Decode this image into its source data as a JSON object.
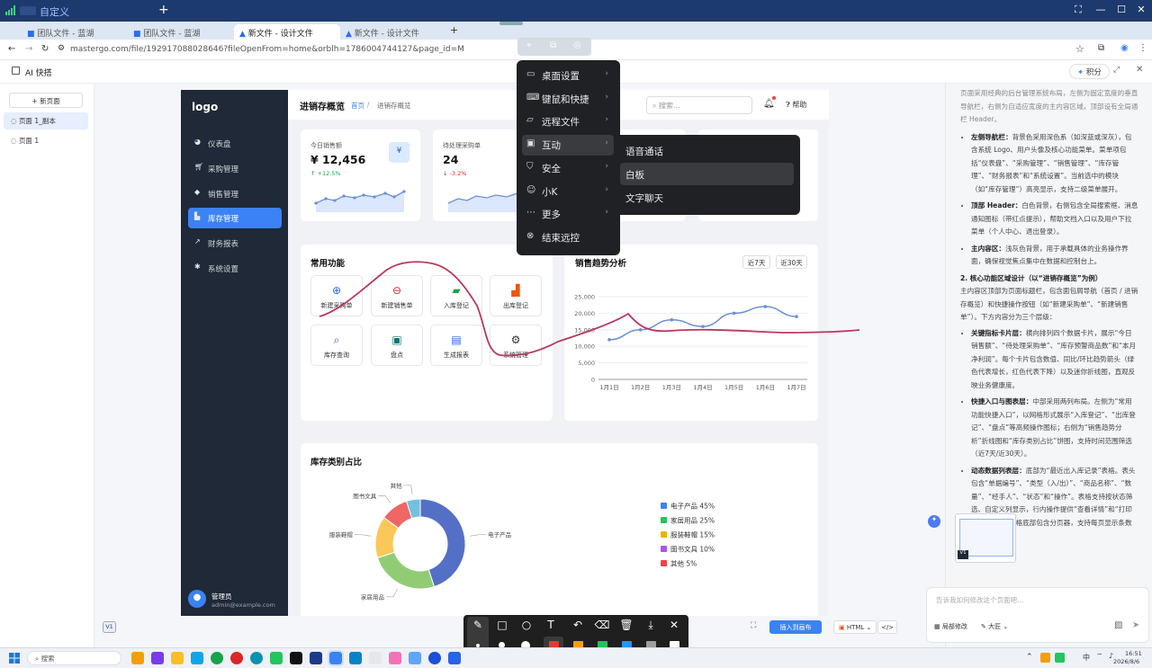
{
  "session": {
    "title": "自定义"
  },
  "browser": {
    "tabs": [
      {
        "label": "团队文件 - 蓝湖"
      },
      {
        "label": "团队文件 - 蓝湖"
      },
      {
        "label": "新文件 - 设计文件"
      },
      {
        "label": "新文件 - 设计文件"
      }
    ],
    "url": "mastergo.com/file/192917088028646?fileOpenFrom=home&orblh=1786004744127&page_id=M"
  },
  "app": {
    "title": "AI 快搭",
    "points_label": "积分"
  },
  "pages_panel": {
    "new_page": "+ 新页面",
    "pages": [
      {
        "label": "页面 1_副本"
      },
      {
        "label": "页面 1"
      }
    ]
  },
  "design": {
    "logo": "logo",
    "nav": [
      {
        "label": "仪表盘",
        "icon": "dashboard-icon"
      },
      {
        "label": "采购管理",
        "icon": "cart-icon"
      },
      {
        "label": "销售管理",
        "icon": "tag-icon"
      },
      {
        "label": "库存管理",
        "icon": "warehouse-icon"
      },
      {
        "label": "财务报表",
        "icon": "chart-icon"
      },
      {
        "label": "系统设置",
        "icon": "gear-icon"
      }
    ],
    "header": {
      "title": "进销存概览",
      "crumb1": "首页",
      "crumb_sep": "/",
      "crumb2": "进销存概览",
      "search_placeholder": "搜索...",
      "help": "帮助"
    },
    "user": {
      "name": "管理员",
      "email": "admin@example.com"
    },
    "stats": [
      {
        "label": "今日销售额",
        "value": "¥ 12,456",
        "change": "+12.5%",
        "badge": "¥"
      },
      {
        "label": "待处理采购单",
        "value": "24",
        "change": "-3.2%"
      }
    ],
    "quick": {
      "title": "常用功能",
      "items": [
        {
          "label": "新建采购单",
          "icon": "plus-circle-icon"
        },
        {
          "label": "新建销售单",
          "icon": "minus-circle-icon"
        },
        {
          "label": "入库登记",
          "icon": "truck-icon"
        },
        {
          "label": "出库登记",
          "icon": "boxes-icon"
        },
        {
          "label": "库存查询",
          "icon": "search-icon"
        },
        {
          "label": "盘点",
          "icon": "clipboard-icon"
        },
        {
          "label": "生成报表",
          "icon": "report-icon"
        },
        {
          "label": "系统管理",
          "icon": "cogs-icon"
        }
      ]
    },
    "trend": {
      "title": "销售趋势分析",
      "btn7": "近7天",
      "btn30": "近30天"
    },
    "pie_title": "库存类别占比",
    "version": "V1"
  },
  "chart_data": [
    {
      "type": "line",
      "x": [
        "1月1日",
        "1月2日",
        "1月3日",
        "1月4日",
        "1月5日",
        "1月6日",
        "1月7日"
      ],
      "series": [
        {
          "values": [
            12000,
            15000,
            18000,
            16000,
            20000,
            22000,
            19000
          ]
        }
      ],
      "ylim": [
        0,
        25000
      ],
      "yticks": [
        "0",
        "5,000",
        "10,000",
        "15,000",
        "20,000",
        "25,000"
      ],
      "color": "#6b8fd8"
    },
    {
      "type": "pie",
      "donut": true,
      "slices": [
        {
          "name": "电子产品",
          "value": 45,
          "color": "#5470c6"
        },
        {
          "name": "家居用品",
          "value": 25,
          "color": "#91cc75"
        },
        {
          "name": "服装鞋帽",
          "value": 15,
          "color": "#fac858"
        },
        {
          "name": "图书文具",
          "value": 10,
          "color": "#ee6666"
        },
        {
          "name": "其他",
          "value": 5,
          "color": "#73c0de"
        }
      ],
      "legend": [
        {
          "text": "电子产品 45%",
          "color": "#3b82f6"
        },
        {
          "text": "家居用品 25%",
          "color": "#22c55e"
        },
        {
          "text": "服装鞋帽 15%",
          "color": "#eab308"
        },
        {
          "text": "图书文具 10%",
          "color": "#a855f7"
        },
        {
          "text": "其他 5%",
          "color": "#ef4444"
        }
      ],
      "legend_position": "right"
    }
  ],
  "context_menu": {
    "items": [
      {
        "label": "桌面设置",
        "icon": "monitor-icon"
      },
      {
        "label": "键鼠和快捷",
        "icon": "keyboard-icon"
      },
      {
        "label": "远程文件",
        "icon": "folder-icon"
      },
      {
        "label": "互动",
        "icon": "interact-icon"
      },
      {
        "label": "安全",
        "icon": "shield-icon"
      },
      {
        "label": "小K",
        "icon": "bot-icon"
      },
      {
        "label": "更多",
        "icon": "more-icon"
      },
      {
        "label": "结束远控",
        "icon": "stop-icon"
      }
    ],
    "submenu": [
      {
        "label": "语音通话"
      },
      {
        "label": "白板"
      },
      {
        "label": "文字聊天"
      }
    ]
  },
  "ai_panel": {
    "intro": "页面采用经典的后台管理系统布局，左侧为固定宽度的垂直导航栏，右侧为自适应宽度的主内容区域，顶部设有全局通栏 Header。",
    "items1": [
      {
        "title": "左侧导航栏：",
        "text": "背景色采用深色系（如深蓝或深灰），包含系统 Logo、用户头像及核心功能菜单。菜单项包括“仪表盘”、“采购管理”、“销售管理”、“库存管理”、“财务报表”和“系统设置”。当前选中的模块（如“库存管理”）高亮显示，支持二级菜单展开。"
      },
      {
        "title": "顶部 Header：",
        "text": "白色背景，右侧包含全局搜索框、消息通知图标（带红点提示），帮助文档入口以及用户下拉菜单（个人中心、退出登录）。"
      },
      {
        "title": "主内容区：",
        "text": "浅灰色背景，用于承载具体的业务操作界面，确保视觉焦点集中在数据和控制台上。"
      }
    ],
    "section2": "2. 核心功能区域设计（以“进销存概览”为例）",
    "section2_text": "主内容区顶部为页面标题栏，包含面包屑导航（首页 / 进销存概览）和快捷操作按钮（如“新建采购单”、“新建销售单”）。下方内容分为三个层级：",
    "items2": [
      {
        "title": "关键指标卡片层：",
        "text": "横向排列四个数据卡片，展示“今日销售额”、“待处理采购单”、“库存预警商品数”和“本月净利润”。每个卡片包含数值、同比/环比趋势箭头（绿色代表增长，红色代表下降）以及迷你折线图，直观反映业务健康度。"
      },
      {
        "title": "快捷入口与图表层：",
        "text": "中部采用两列布局。左侧为“常用功能快捷入口”，以网格形式展示“入库登记”、“出库登记”、“盘点”等高频操作图标；右侧为“销售趋势分析”折线图和“库存类别占比”饼图，支持时间范围筛选（近7天/近30天）。"
      },
      {
        "title": "动态数据列表层：",
        "text": "底部为“最近出入库记录”表格。表头包含“单据编号”、“类型（入/出）”、“商品名称”、“数量”、“经手人”、“状态”和“操作”。表格支持按状态筛选、自定义列显示，行内操作提供“查看详情”和“打印单据”按钮。表格底部包含分页器，支持每页显示条数调整。"
      }
    ],
    "input_placeholder": "告诉我如何修改这个页面吧...",
    "btn_partial": "局部修改",
    "btn_model": "大匠"
  },
  "bottom": {
    "insert": "插入到画布",
    "html": "HTML",
    "code": "</>"
  },
  "taskbar": {
    "search": "搜索",
    "lang": "中",
    "time": "16:51",
    "date": "2026/8/6"
  }
}
